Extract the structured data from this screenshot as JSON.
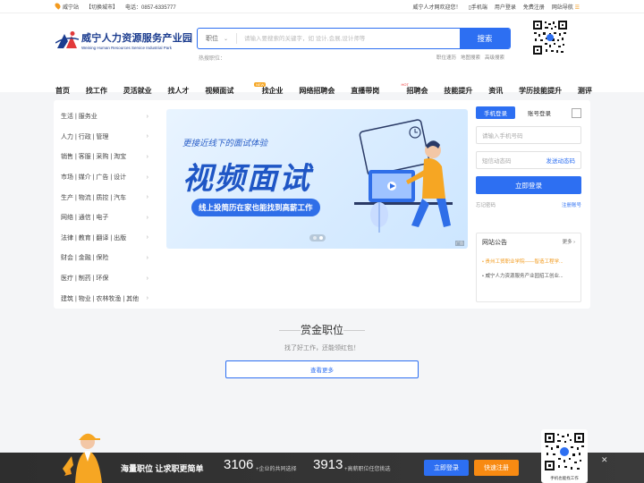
{
  "topbar": {
    "location": "威宁站",
    "switch_city": "【切换城市】",
    "phone": "电话：0857-6335777",
    "welcome": "威宁人才网欢迎您！",
    "mobile": "手机端",
    "user_login": "用户登录",
    "register": "免费注册",
    "sitemap": "网站导航"
  },
  "logo": {
    "name": "威宁人力资源服务产业园",
    "english": "Weining Human Resources Service Industrial Park"
  },
  "search": {
    "type": "职位",
    "placeholder": "请输入要搜索的关键字，如 设计,会展,设计师等",
    "button": "搜索",
    "hot_label": "热搜职位：",
    "links": [
      "职位速历",
      "地图搜索",
      "高级搜索"
    ]
  },
  "nav": {
    "items": [
      {
        "label": "首页",
        "badge": ""
      },
      {
        "label": "找工作",
        "badge": ""
      },
      {
        "label": "灵活就业",
        "badge": ""
      },
      {
        "label": "找人才",
        "badge": ""
      },
      {
        "label": "视频面试",
        "badge": "NEW"
      },
      {
        "label": "找企业",
        "badge": ""
      },
      {
        "label": "网络招聘会",
        "badge": ""
      },
      {
        "label": "直播带岗",
        "badge": "HOT"
      },
      {
        "label": "招聘会",
        "badge": ""
      },
      {
        "label": "技能提升",
        "badge": ""
      },
      {
        "label": "资讯",
        "badge": ""
      },
      {
        "label": "学历技能提升",
        "badge": ""
      },
      {
        "label": "测评",
        "badge": ""
      }
    ]
  },
  "categories": [
    "生活 | 服务业",
    "人力 | 行政 | 管理",
    "销售 | 客服 | 采购 | 淘宝",
    "市场 | 媒介 | 广告 | 设计",
    "生产 | 物流 | 质控 | 汽车",
    "网络 | 通信 | 电子",
    "法律 | 教育 | 翻译 | 出版",
    "财会 | 金融 | 保险",
    "医疗 | 制药 | 环保",
    "建筑 | 物业 | 农林牧渔 | 其他"
  ],
  "banner": {
    "tagline": "更接近线下的面试体验",
    "title": "视频面试",
    "subtitle": "线上投简历在家也能找到高薪工作",
    "ad": "广告"
  },
  "login": {
    "tab_phone": "手机登录",
    "tab_account": "账号登录",
    "phone_placeholder": "请输入手机号码",
    "code_placeholder": "短信动态码",
    "send_code": "发送动态码",
    "submit": "立即登录",
    "forgot": "忘记密码",
    "register": "注册账号"
  },
  "notice": {
    "title": "网站公告",
    "more": "更多",
    "items": [
      "贵州工贸职业学院——智造工程学...",
      "威宁人力资源服务产业园招工创业..."
    ]
  },
  "reward": {
    "title": "赏金职位",
    "subtitle": "找了好工作，还能领红包！",
    "more": "查看更多"
  },
  "footer": {
    "slogan": "海量职位 让求职更简单",
    "count1": "3106",
    "desc1": "+企业的共同选择",
    "count2": "3913",
    "desc2": "+高薪职位任您挑选",
    "login": "立即登录",
    "register": "快速注册",
    "qr_caption": "手机也能找工作"
  },
  "colors": {
    "primary": "#2d6ff2",
    "accent": "#f88a12"
  }
}
